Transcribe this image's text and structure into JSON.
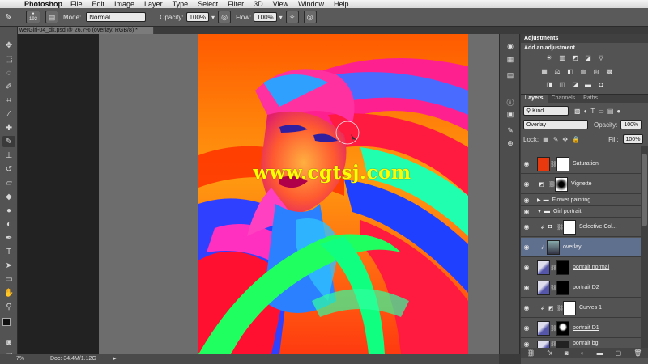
{
  "menu": {
    "app": "Photoshop",
    "items": [
      "File",
      "Edit",
      "Image",
      "Layer",
      "Type",
      "Select",
      "Filter",
      "3D",
      "View",
      "Window",
      "Help"
    ]
  },
  "options_bar": {
    "brush_size": "192",
    "mode_label": "Mode:",
    "mode_value": "Normal",
    "opacity_label": "Opacity:",
    "opacity_value": "100%",
    "flow_label": "Flow:",
    "flow_value": "100%"
  },
  "document": {
    "tab_title": "werGirl-04_dk.psd @ 26.7% (overlay, RGB/8) *",
    "zoom": "7%",
    "doc_size": "Doc: 34.4M/1.12G",
    "watermark": "www.cgtsj.com"
  },
  "adjustments": {
    "tab": "Adjustments",
    "heading": "Add an adjustment"
  },
  "layers_panel": {
    "tabs": [
      "Layers",
      "Channels",
      "Paths"
    ],
    "filter_value": "Kind",
    "blend_mode": "Overlay",
    "opacity_label": "Opacity:",
    "opacity_value": "100%",
    "lock_label": "Lock:",
    "fill_label": "Fill:",
    "fill_value": "100%",
    "layers": [
      {
        "name": "Saturation"
      },
      {
        "name": "Vignette"
      },
      {
        "name": "Flower painting"
      },
      {
        "name": "Girl portrait"
      },
      {
        "name": "Selective Col..."
      },
      {
        "name": "overlay"
      },
      {
        "name": "portrait normal"
      },
      {
        "name": "portrait D2"
      },
      {
        "name": "Curves 1"
      },
      {
        "name": "portrait D1"
      },
      {
        "name": "portrait bg"
      }
    ]
  },
  "colors": {
    "ui_dark": "#535353",
    "selected_layer": "#5f6f8e",
    "watermark": "#ffff00",
    "saturation_swatch": "#e8380d"
  }
}
